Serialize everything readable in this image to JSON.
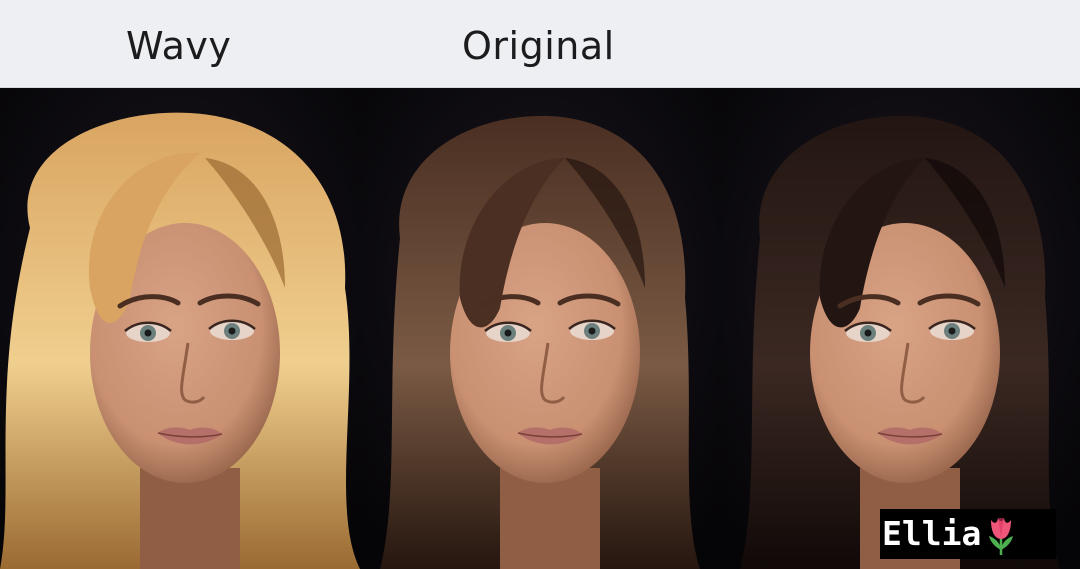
{
  "header": {
    "labels": [
      "Wavy",
      "Original"
    ]
  },
  "panels": [
    {
      "hair_color": "#d9a461",
      "hair_highlight": "#f0cf8e",
      "hair_shadow": "#9a6a32",
      "style": "wavy"
    },
    {
      "hair_color": "#4a2f22",
      "hair_highlight": "#7a5a44",
      "hair_shadow": "#25160f",
      "style": "original"
    },
    {
      "hair_color": "#231612",
      "hair_highlight": "#3b2822",
      "hair_shadow": "#100908",
      "style": "dark"
    }
  ],
  "watermark": {
    "text": "Ellia",
    "icon": "tulip-icon"
  },
  "colors": {
    "header_bg": "#eeeff2",
    "header_text": "#1c1c1e",
    "background": "#0b0a0c",
    "skin": "#c99072",
    "skin_shadow": "#8f5e45",
    "eye": "#6b7f7c",
    "lip": "#b5706a",
    "tulip": "#f0567a",
    "leaf": "#4caf50"
  }
}
